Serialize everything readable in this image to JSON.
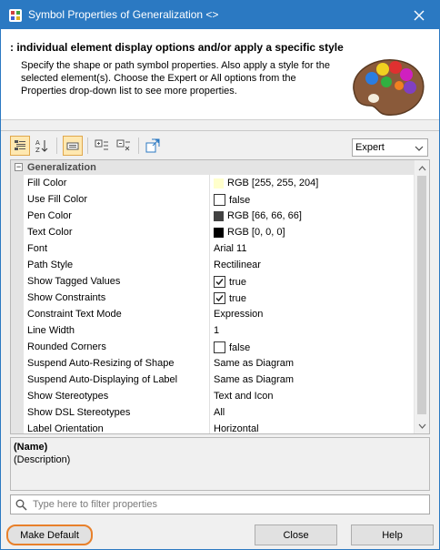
{
  "window": {
    "title": "Symbol Properties of Generalization <>",
    "accent_color": "#2b79c2"
  },
  "header": {
    "title": ": individual element display options and/or apply a specific style",
    "description": "Specify the shape or path symbol properties. Also apply a style for the selected element(s). Choose the Expert or All options from the Properties drop-down list to see more properties.",
    "image_icon": "paint-palette-icon"
  },
  "toolbar": {
    "buttons": [
      "categorized-view-icon",
      "alphabetic-sort-icon",
      "show-description-icon",
      "expand-all-icon",
      "collapse-all-icon",
      "apply-style-icon"
    ],
    "mode_selected": "Expert"
  },
  "grid": {
    "group_name": "Generalization",
    "rows": [
      {
        "name": "Fill Color",
        "value": "RGB [255, 255, 204]",
        "kind": "color",
        "color": "#ffffcc"
      },
      {
        "name": "Use Fill Color",
        "value": "false",
        "kind": "check",
        "checked": false
      },
      {
        "name": "Pen Color",
        "value": "RGB [66, 66, 66]",
        "kind": "color",
        "color": "#424242"
      },
      {
        "name": "Text Color",
        "value": "RGB [0, 0, 0]",
        "kind": "color",
        "color": "#000000"
      },
      {
        "name": "Font",
        "value": "Arial 11",
        "kind": "text"
      },
      {
        "name": "Path Style",
        "value": "Rectilinear",
        "kind": "text"
      },
      {
        "name": "Show Tagged Values",
        "value": "true",
        "kind": "check",
        "checked": true
      },
      {
        "name": "Show Constraints",
        "value": "true",
        "kind": "check",
        "checked": true
      },
      {
        "name": "Constraint Text Mode",
        "value": "Expression",
        "kind": "text"
      },
      {
        "name": "Line Width",
        "value": "1",
        "kind": "text"
      },
      {
        "name": "Rounded Corners",
        "value": "false",
        "kind": "check",
        "checked": false
      },
      {
        "name": "Suspend Auto-Resizing of Shape",
        "value": "Same as Diagram",
        "kind": "text"
      },
      {
        "name": "Suspend Auto-Displaying of Label",
        "value": "Same as Diagram",
        "kind": "text"
      },
      {
        "name": "Show Stereotypes",
        "value": "Text and Icon",
        "kind": "text"
      },
      {
        "name": "Show DSL Stereotypes",
        "value": "All",
        "kind": "text"
      },
      {
        "name": "Label Orientation",
        "value": "Horizontal",
        "kind": "text"
      }
    ]
  },
  "description_panel": {
    "name": "(Name)",
    "text": "(Description)"
  },
  "filter": {
    "placeholder": "Type here to filter properties",
    "value": ""
  },
  "buttons": {
    "make_default": "Make Default",
    "close": "Close",
    "help": "Help",
    "highlight_color": "#e8802a"
  }
}
